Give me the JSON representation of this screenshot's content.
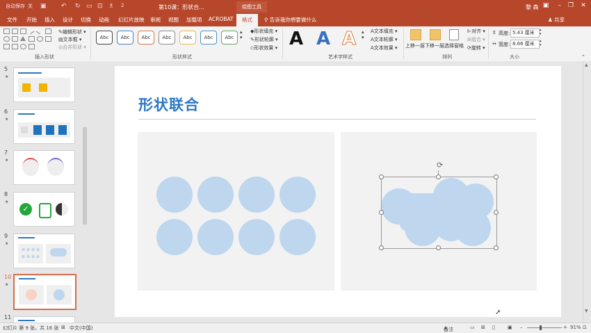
{
  "titlebar": {
    "autosave": "自动保存",
    "autosave_state": "关",
    "qa_num": "2",
    "title": "第10课：形状合...",
    "context_tab": "绘图工具",
    "user": "黎 森"
  },
  "tabs": [
    "文件",
    "开始",
    "插入",
    "设计",
    "切换",
    "动画",
    "幻灯片放映",
    "审阅",
    "视图",
    "加载项",
    "ACROBAT",
    "格式"
  ],
  "active_tab": "格式",
  "tell_me": "告诉我你想要做什么",
  "share": "共享",
  "ribbon": {
    "insert_shapes": {
      "label": "插入形状",
      "edit_shape": "编辑形状",
      "text_box": "文本框",
      "merge_shapes": "合并形状"
    },
    "shape_styles": {
      "label": "形状样式",
      "swatch_text": "Abc",
      "swatch_colors": [
        "#444444",
        "#4a7fc1",
        "#d9734a",
        "#8c8c8c",
        "#e8b84a",
        "#4a90c8",
        "#5fa75f"
      ],
      "fill": "形状填充",
      "outline": "形状轮廓",
      "effects": "形状效果"
    },
    "wordart": {
      "label": "艺术字样式",
      "letter": "A",
      "text_fill": "文本填充",
      "text_outline": "文本轮廓",
      "text_effects": "文本效果"
    },
    "arrange": {
      "label": "排列",
      "bring_forward": "上移一层",
      "send_backward": "下移一层",
      "selection_pane": "选择窗格",
      "align": "对齐",
      "group": "组合",
      "rotate": "旋转"
    },
    "size": {
      "label": "大小",
      "height_label": "高度:",
      "height_value": "5.43 厘米",
      "width_label": "宽度:",
      "width_value": "8.66 厘米"
    }
  },
  "thumbnails": [
    {
      "num": "5",
      "star": "★"
    },
    {
      "num": "6",
      "star": "★"
    },
    {
      "num": "7",
      "star": "★"
    },
    {
      "num": "8",
      "star": "★"
    },
    {
      "num": "9",
      "star": "★"
    },
    {
      "num": "10",
      "star": "★"
    },
    {
      "num": "11",
      "star": "★"
    }
  ],
  "slide": {
    "title": "形状联合"
  },
  "status": {
    "slide_info": "幻灯片 第 9 张，共 16 张",
    "language": "中文(中国)",
    "notes": "备注",
    "zoom": "91%"
  },
  "colors": {
    "accent": "#b7472a",
    "title_blue": "#2b78c5",
    "circle_fill": "#bed6ee"
  }
}
